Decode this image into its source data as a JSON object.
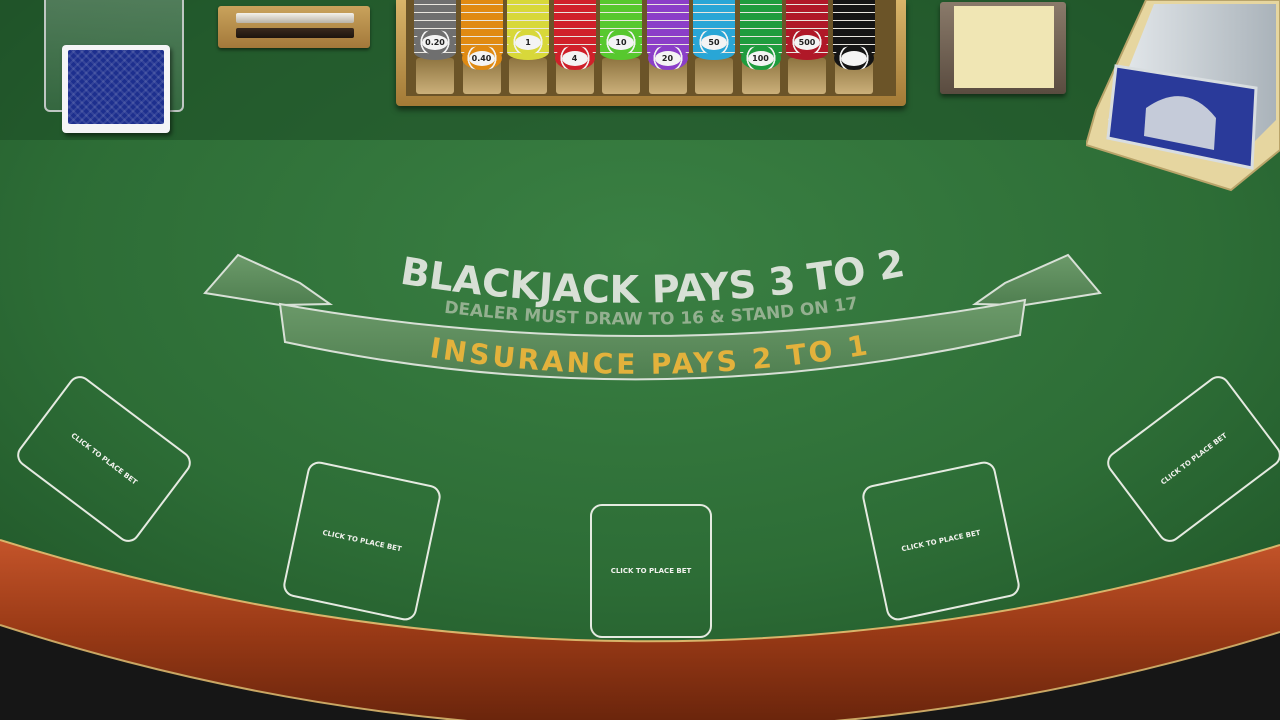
{
  "table": {
    "felt_color": "#2b6b35",
    "rail_color": "#a8411c",
    "headline": "BLACKJACK PAYS 3 TO 2",
    "dealer_rule": "DEALER MUST DRAW TO 16 & STAND ON 17",
    "insurance_rule": "INSURANCE PAYS 2 TO 1",
    "headline_color": "#d8e0d6",
    "insurance_color": "#e3b23c"
  },
  "chip_tray": {
    "chips": [
      {
        "value": "0.20",
        "color": "#6f6f6f"
      },
      {
        "value": "0.40",
        "color": "#e08a12"
      },
      {
        "value": "1",
        "color": "#d8d83a"
      },
      {
        "value": "4",
        "color": "#d0202a"
      },
      {
        "value": "10",
        "color": "#57c82e"
      },
      {
        "value": "20",
        "color": "#8b3ec8"
      },
      {
        "value": "50",
        "color": "#29a6d6"
      },
      {
        "value": "100",
        "color": "#1f9c3e"
      },
      {
        "value": "500",
        "color": "#b01828"
      },
      {
        "value": "",
        "color": "#151515"
      }
    ]
  },
  "bet_spots": [
    {
      "label": "CLICK TO PLACE BET"
    },
    {
      "label": "CLICK TO PLACE BET"
    },
    {
      "label": "CLICK TO PLACE BET"
    },
    {
      "label": "CLICK TO PLACE BET"
    },
    {
      "label": "CLICK TO PLACE BET"
    }
  ]
}
